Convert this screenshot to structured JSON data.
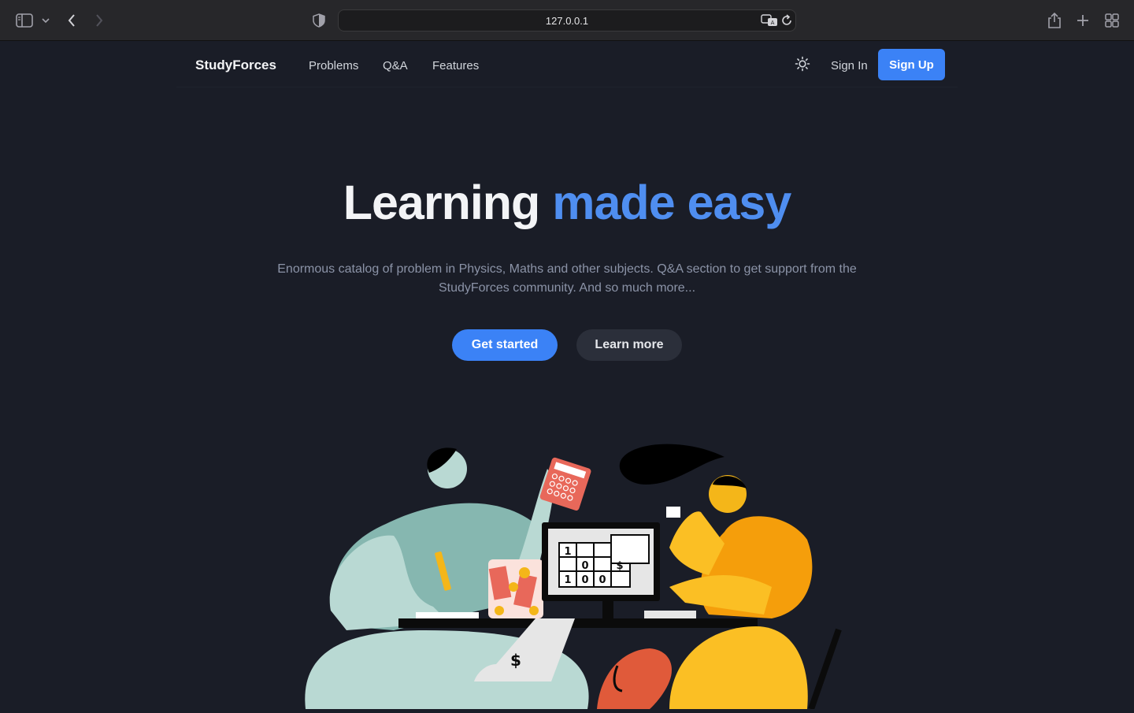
{
  "browser": {
    "url": "127.0.0.1",
    "icons": [
      "sidebar-toggle-icon",
      "chevron-down-icon",
      "back-icon",
      "forward-icon",
      "privacy-shield-icon",
      "translate-icon",
      "reload-icon",
      "share-icon",
      "new-tab-icon",
      "tab-overview-icon"
    ]
  },
  "nav": {
    "brand": "StudyForces",
    "links": [
      "Problems",
      "Q&A",
      "Features"
    ],
    "theme_icon": "sun-icon",
    "signin": "Sign In",
    "signup": "Sign Up"
  },
  "hero": {
    "title_plain": "Learning",
    "title_accent": "made easy",
    "subtitle_line1": "Enormous catalog of problem in Physics, Maths and other subjects. Q&A section to get support from the",
    "subtitle_line2": "StudyForces community. And so much more...",
    "primary_cta": "Get started",
    "secondary_cta": "Learn more"
  },
  "illustration": {
    "receipt_symbol": "$",
    "spreadsheet_digits": [
      "1",
      "0",
      "1",
      "0",
      "0"
    ],
    "spreadsheet_symbol": "$"
  },
  "colors": {
    "background": "#1a1d27",
    "accent": "#3b82f6",
    "title_accent": "#4f8ef0"
  }
}
